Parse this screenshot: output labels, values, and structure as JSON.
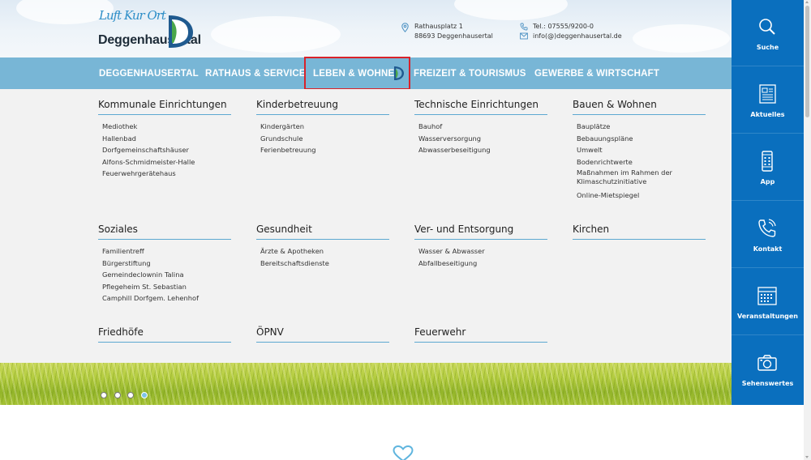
{
  "header": {
    "logo": {
      "script_text": "Luft Kur Ort",
      "name": "Deggenhausertal"
    },
    "address": {
      "line1": "Rathausplatz 1",
      "line2": "88693 Deggenhausertal",
      "icon": "location-pin-icon"
    },
    "contact": {
      "phone": "Tel.: 07555/9200-0",
      "email": "info(@)deggenhausertal.de",
      "phone_icon": "phone-icon",
      "email_icon": "mail-icon"
    }
  },
  "nav": {
    "items": [
      {
        "label": "DEGGENHAUSERTAL"
      },
      {
        "label": "RATHAUS & SERVICE"
      },
      {
        "label": "LEBEN & WOHNEN",
        "active": true
      },
      {
        "label": "FREIZEIT & TOURISMUS"
      },
      {
        "label": "GEWERBE & WIRTSCHAFT"
      }
    ]
  },
  "dropdown": {
    "columns": [
      {
        "title": "Kommunale Einrichtungen",
        "links": [
          "Mediothek",
          "Hallenbad",
          "Dorfgemeinschaftshäuser",
          "Alfons-Schmidmeister-Halle",
          "Feuerwehrgerätehaus"
        ]
      },
      {
        "title": "Kinderbetreuung",
        "links": [
          "Kindergärten",
          "Grundschule",
          "Ferienbetreuung"
        ]
      },
      {
        "title": "Technische Einrichtungen",
        "links": [
          "Bauhof",
          "Wasserversorgung",
          "Abwasserbeseitigung"
        ]
      },
      {
        "title": "Bauen & Wohnen",
        "links": [
          "Bauplätze",
          "Bebauungspläne",
          "Umwelt",
          "Bodenrichtwerte",
          "Maßnahmen im Rahmen der Klimaschutzinitiative",
          "Online-Mietspiegel"
        ]
      },
      {
        "title": "Soziales",
        "links": [
          "Familientreff",
          "Bürgerstiftung",
          "Gemeindeclownin Talina",
          "Pflegeheim St. Sebastian",
          "Camphill Dorfgem. Lehenhof"
        ]
      },
      {
        "title": "Gesundheit",
        "links": [
          "Ärzte & Apotheken",
          "Bereitschaftsdienste"
        ]
      },
      {
        "title": "Ver- und Entsorgung",
        "links": [
          "Wasser & Abwasser",
          "Abfallbeseitigung"
        ]
      },
      {
        "title": "Kirchen",
        "links": []
      },
      {
        "title": "Friedhöfe",
        "links": []
      },
      {
        "title": "ÖPNV",
        "links": []
      },
      {
        "title": "Feuerwehr",
        "links": []
      }
    ]
  },
  "slider": {
    "slide_count": 4,
    "active_slide": 4
  },
  "sidebar": {
    "items": [
      {
        "label": "Suche",
        "icon": "search-icon"
      },
      {
        "label": "Aktuelles",
        "icon": "news-icon"
      },
      {
        "label": "App",
        "icon": "smartphone-icon"
      },
      {
        "label": "Kontakt",
        "icon": "phone-icon"
      },
      {
        "label": "Veranstaltungen",
        "icon": "calendar-icon"
      },
      {
        "label": "Sehenswertes",
        "icon": "camera-icon"
      }
    ]
  },
  "colors": {
    "nav_bg": "#78b6d6",
    "sidebar_bg": "#0a6fbe",
    "active_outline": "#d9222a",
    "accent_line": "#5da8d1"
  }
}
